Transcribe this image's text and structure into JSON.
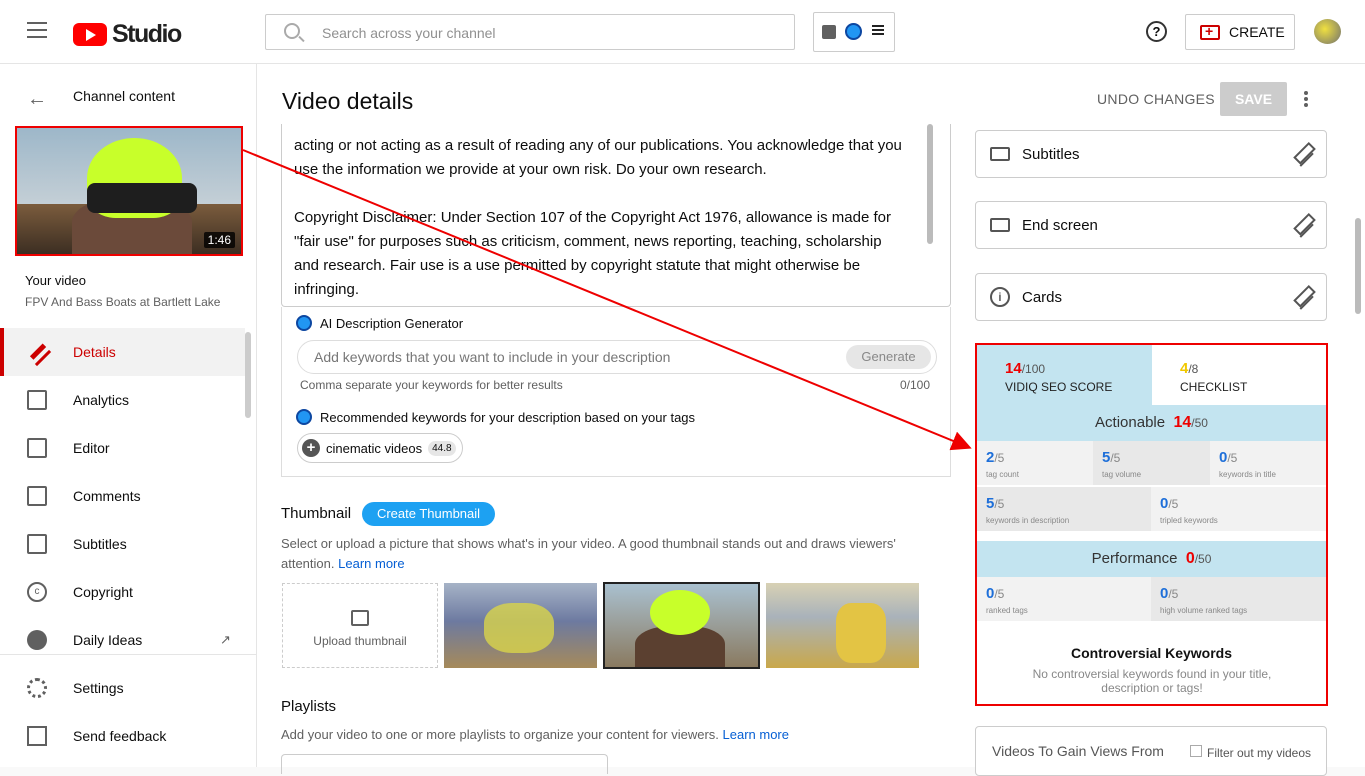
{
  "header": {
    "logo_text": "Studio",
    "search_placeholder": "Search across your channel",
    "help_icon": "?",
    "create_label": "CREATE"
  },
  "sidebar": {
    "back_label": "Channel content",
    "video_duration": "1:46",
    "your_video_label": "Your video",
    "video_title": "FPV And Bass Boats at Bartlett Lake",
    "items": [
      {
        "label": "Details",
        "icon": "pencil-icon"
      },
      {
        "label": "Analytics",
        "icon": "analytics-icon"
      },
      {
        "label": "Editor",
        "icon": "editor-icon"
      },
      {
        "label": "Comments",
        "icon": "comments-icon"
      },
      {
        "label": "Subtitles",
        "icon": "subtitles-icon"
      },
      {
        "label": "Copyright",
        "icon": "copyright-icon"
      },
      {
        "label": "Daily Ideas",
        "icon": "vidiq-icon"
      }
    ],
    "bottom_items": [
      {
        "label": "Settings",
        "icon": "gear-icon"
      },
      {
        "label": "Send feedback",
        "icon": "feedback-icon"
      }
    ]
  },
  "main": {
    "title": "Video details",
    "undo_label": "UNDO CHANGES",
    "save_label": "SAVE",
    "description": {
      "p1": "acting or not acting as a result of reading any of our publications. You acknowledge that you use the information we provide at your own risk. Do your own research.",
      "p2": "Copyright Disclaimer: Under Section 107 of the Copyright Act 1976, allowance is made for \"fair use\" for purposes such as criticism, comment, news reporting, teaching, scholarship and research. Fair use is a use permitted by copyright statute that might otherwise be infringing."
    },
    "ai": {
      "title": "AI Description Generator",
      "placeholder": "Add keywords that you want to include in your description",
      "generate_label": "Generate",
      "hint": "Comma separate your keywords for better results",
      "count": "0/100",
      "recommended_label": "Recommended keywords for your description based on your tags",
      "chip_label": "cinematic videos",
      "chip_score": "44.8"
    },
    "thumbnail": {
      "label": "Thumbnail",
      "create_label": "Create Thumbnail",
      "desc": "Select or upload a picture that shows what's in your video. A good thumbnail stands out and draws viewers' attention.",
      "learn_more": "Learn more",
      "upload_label": "Upload thumbnail"
    },
    "playlists": {
      "label": "Playlists",
      "desc": "Add your video to one or more playlists to organize your content for viewers.",
      "learn_more": "Learn more"
    }
  },
  "right": {
    "cards": [
      {
        "label": "Subtitles"
      },
      {
        "label": "End screen"
      },
      {
        "label": "Cards"
      }
    ],
    "seo": {
      "score": "14",
      "score_max": "/100",
      "score_label": "VIDIQ SEO SCORE",
      "checklist": "4",
      "checklist_max": "/8",
      "checklist_label": "CHECKLIST",
      "actionable_label": "Actionable",
      "actionable_score": "14",
      "actionable_max": "/50",
      "metrics": [
        {
          "v": "2",
          "max": "/5",
          "desc": "tag count"
        },
        {
          "v": "5",
          "max": "/5",
          "desc": "tag volume"
        },
        {
          "v": "0",
          "max": "/5",
          "desc": "keywords in title"
        },
        {
          "v": "5",
          "max": "/5",
          "desc": "keywords in description"
        },
        {
          "v": "0",
          "max": "/5",
          "desc": "tripled keywords"
        }
      ],
      "performance_label": "Performance",
      "performance_score": "0",
      "performance_max": "/50",
      "perf_metrics": [
        {
          "v": "0",
          "max": "/5",
          "desc": "ranked tags"
        },
        {
          "v": "0",
          "max": "/5",
          "desc": "high volume ranked tags"
        }
      ],
      "controversial_title": "Controversial Keywords",
      "controversial_desc": "No controversial keywords found in your title, description or tags!"
    },
    "videos_gain": "Videos To Gain Views From",
    "filter_label": "Filter out my videos"
  },
  "colors": {
    "accent": "#cc0000",
    "vidiq_blue": "#c3e4f0",
    "link": "#065fd4"
  }
}
